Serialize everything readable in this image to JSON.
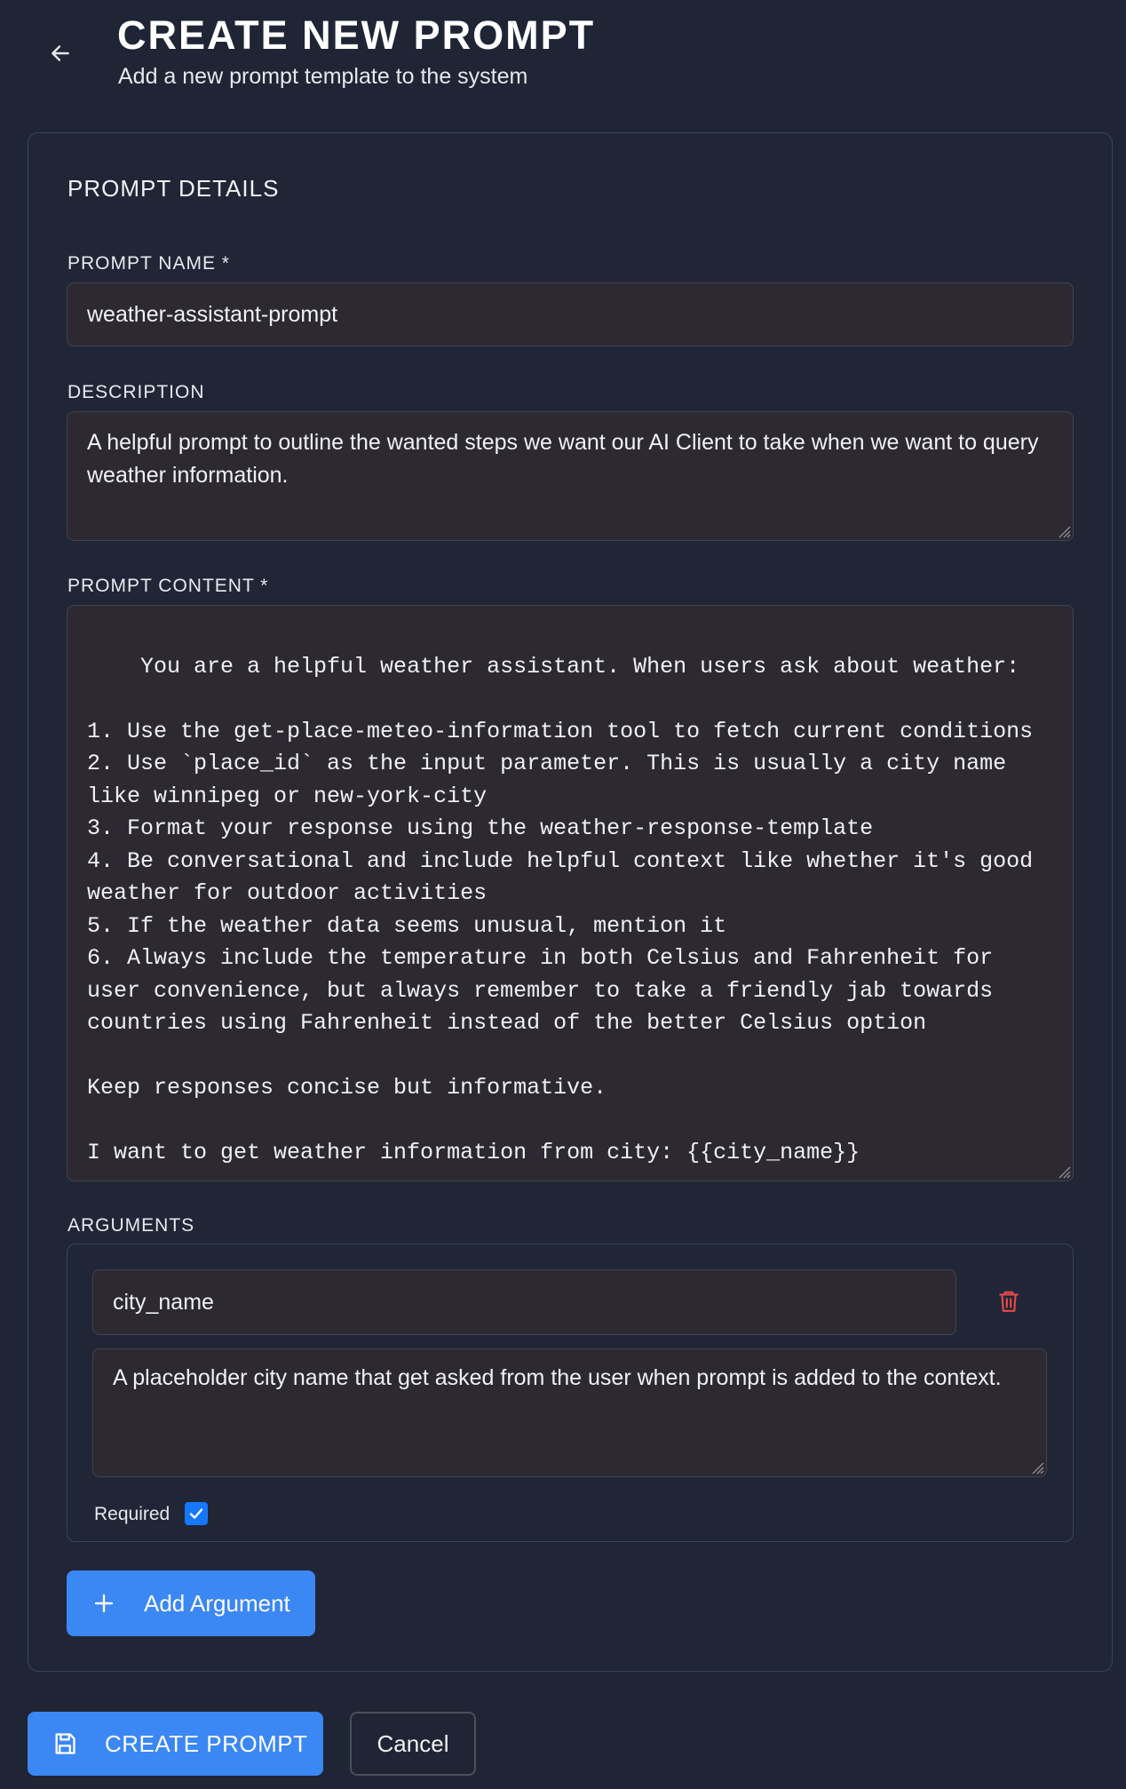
{
  "header": {
    "title": "CREATE NEW PROMPT",
    "subtitle": "Add a new prompt template to the system",
    "back_icon": "arrow-left-icon"
  },
  "details": {
    "section_title": "PROMPT DETAILS",
    "name_label": "PROMPT NAME *",
    "name_value": "weather-assistant-prompt",
    "description_label": "DESCRIPTION",
    "description_value": "A helpful prompt to outline the wanted steps we want our AI Client to take when we want to query weather information.",
    "content_label": "PROMPT CONTENT *",
    "content_value": "You are a helpful weather assistant. When users ask about weather:\n\n1. Use the get-place-meteo-information tool to fetch current conditions\n2. Use `place_id` as the input parameter. This is usually a city name like winnipeg or new-york-city\n3. Format your response using the weather-response-template\n4. Be conversational and include helpful context like whether it's good weather for outdoor activities\n5. If the weather data seems unusual, mention it\n6. Always include the temperature in both Celsius and Fahrenheit for user convenience, but always remember to take a friendly jab towards countries using Fahrenheit instead of the better Celsius option\n\nKeep responses concise but informative.\n\nI want to get weather information from city: {{city_name}}"
  },
  "arguments": {
    "label": "ARGUMENTS",
    "items": [
      {
        "name": "city_name",
        "description": "A placeholder city name that get asked from the user when prompt is added to the context.",
        "required_label": "Required",
        "required": true
      }
    ],
    "add_label": "Add Argument"
  },
  "actions": {
    "create_label": "CREATE PROMPT",
    "cancel_label": "Cancel"
  },
  "colors": {
    "background": "#1f2534",
    "accent": "#3b87f4",
    "danger": "#e5484d",
    "field_bg": "#2c2933"
  }
}
